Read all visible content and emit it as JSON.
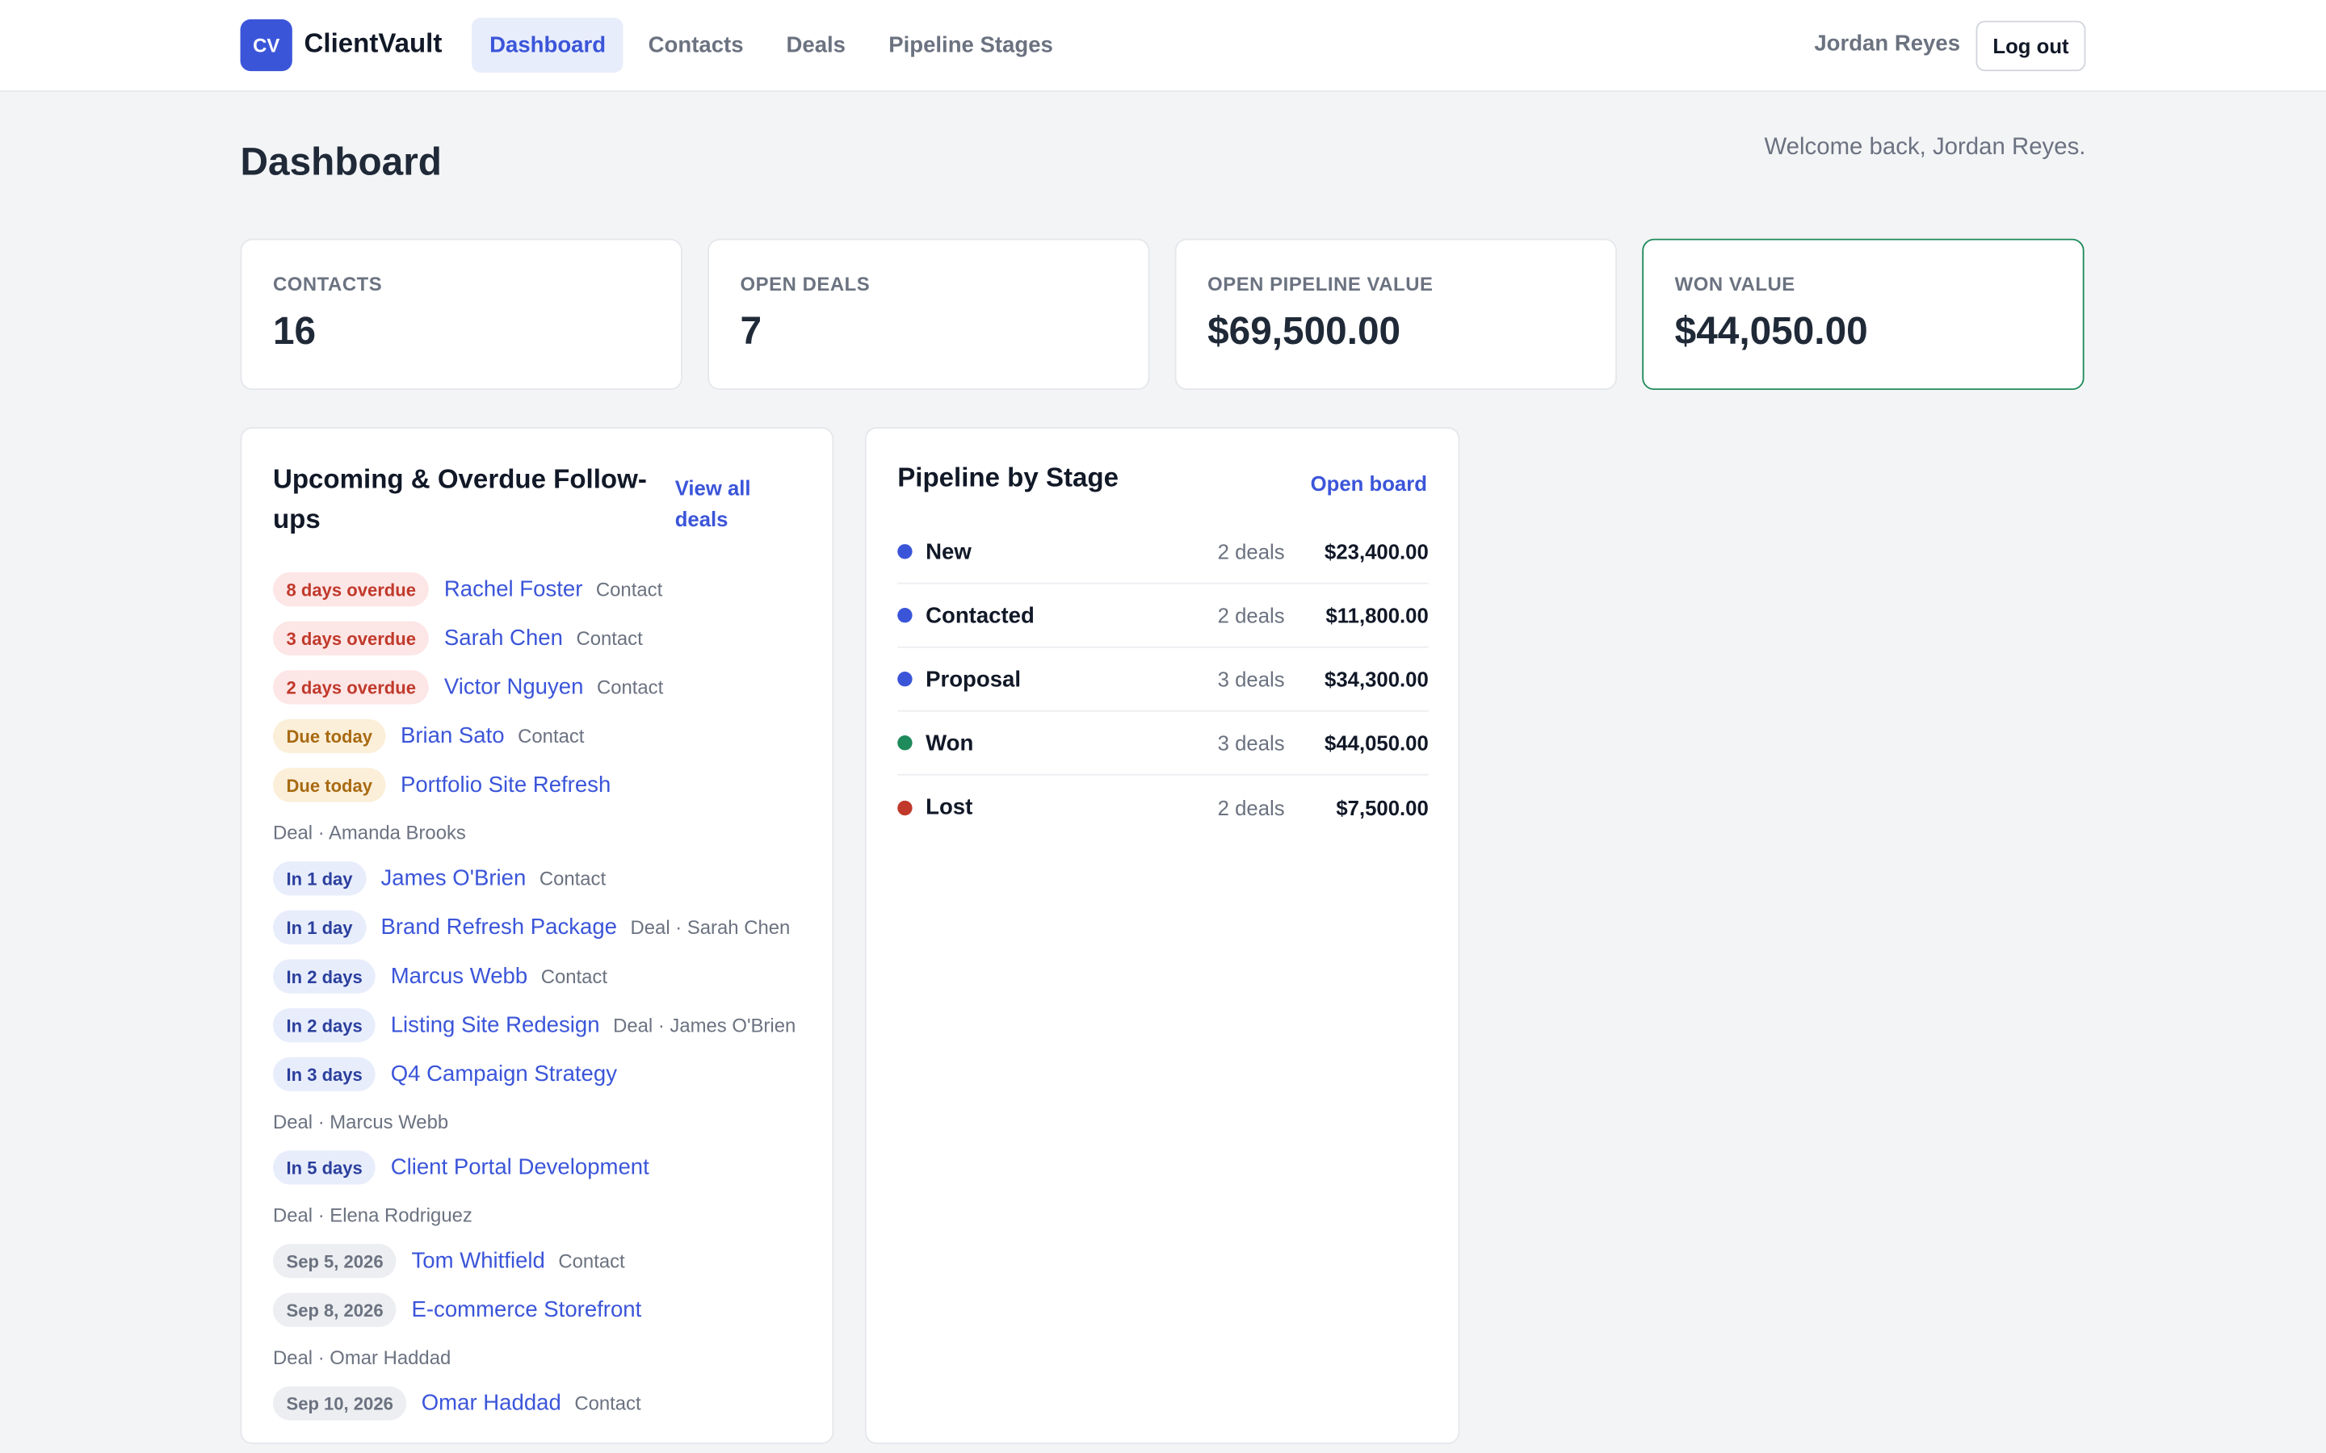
{
  "header": {
    "logo_initials": "CV",
    "app_name": "ClientVault",
    "nav": [
      {
        "label": "Dashboard",
        "active": true
      },
      {
        "label": "Contacts",
        "active": false
      },
      {
        "label": "Deals",
        "active": false
      },
      {
        "label": "Pipeline Stages",
        "active": false
      }
    ],
    "user_name": "Jordan Reyes",
    "logout_label": "Log out"
  },
  "page": {
    "title": "Dashboard",
    "welcome": "Welcome back, Jordan Reyes."
  },
  "stats": [
    {
      "label": "CONTACTS",
      "value": "16"
    },
    {
      "label": "OPEN DEALS",
      "value": "7"
    },
    {
      "label": "OPEN PIPELINE VALUE",
      "value": "$69,500.00"
    },
    {
      "label": "WON VALUE",
      "value": "$44,050.00"
    }
  ],
  "followups": {
    "title": "Upcoming & Overdue Follow-ups",
    "view_all_label": "View all deals",
    "items": [
      {
        "badge": "8 days overdue",
        "status": "overdue",
        "name": "Rachel Foster",
        "meta": "Contact",
        "sub": ""
      },
      {
        "badge": "3 days overdue",
        "status": "overdue",
        "name": "Sarah Chen",
        "meta": "Contact",
        "sub": ""
      },
      {
        "badge": "2 days overdue",
        "status": "overdue",
        "name": "Victor Nguyen",
        "meta": "Contact",
        "sub": ""
      },
      {
        "badge": "Due today",
        "status": "today",
        "name": "Brian Sato",
        "meta": "Contact",
        "sub": ""
      },
      {
        "badge": "Due today",
        "status": "today",
        "name": "Portfolio Site Refresh",
        "meta": "",
        "sub": "Deal · Amanda Brooks"
      },
      {
        "badge": "In 1 day",
        "status": "upcoming",
        "name": "James O'Brien",
        "meta": "Contact",
        "sub": ""
      },
      {
        "badge": "In 1 day",
        "status": "upcoming",
        "name": "Brand Refresh Package",
        "meta": "Deal · Sarah Chen",
        "sub": ""
      },
      {
        "badge": "In 2 days",
        "status": "upcoming",
        "name": "Marcus Webb",
        "meta": "Contact",
        "sub": ""
      },
      {
        "badge": "In 2 days",
        "status": "upcoming",
        "name": "Listing Site Redesign",
        "meta": "Deal · James O'Brien",
        "sub": ""
      },
      {
        "badge": "In 3 days",
        "status": "upcoming",
        "name": "Q4 Campaign Strategy",
        "meta": "",
        "sub": "Deal · Marcus Webb"
      },
      {
        "badge": "In 5 days",
        "status": "upcoming",
        "name": "Client Portal Development",
        "meta": "",
        "sub": "Deal · Elena Rodriguez"
      },
      {
        "badge": "Sep 5, 2026",
        "status": "date",
        "name": "Tom Whitfield",
        "meta": "Contact",
        "sub": ""
      },
      {
        "badge": "Sep 8, 2026",
        "status": "date",
        "name": "E-commerce Storefront",
        "meta": "",
        "sub": "Deal · Omar Haddad"
      },
      {
        "badge": "Sep 10, 2026",
        "status": "date",
        "name": "Omar Haddad",
        "meta": "Contact",
        "sub": ""
      }
    ]
  },
  "pipeline": {
    "title": "Pipeline by Stage",
    "open_board_label": "Open board",
    "stages": [
      {
        "name": "New",
        "count": "2 deals",
        "amount": "$23,400.00",
        "color": "#3b55d9"
      },
      {
        "name": "Contacted",
        "count": "2 deals",
        "amount": "$11,800.00",
        "color": "#3b55d9"
      },
      {
        "name": "Proposal",
        "count": "3 deals",
        "amount": "$34,300.00",
        "color": "#3b55d9"
      },
      {
        "name": "Won",
        "count": "3 deals",
        "amount": "$44,050.00",
        "color": "#1f8a5b"
      },
      {
        "name": "Lost",
        "count": "2 deals",
        "amount": "$7,500.00",
        "color": "#c0392b"
      }
    ]
  }
}
